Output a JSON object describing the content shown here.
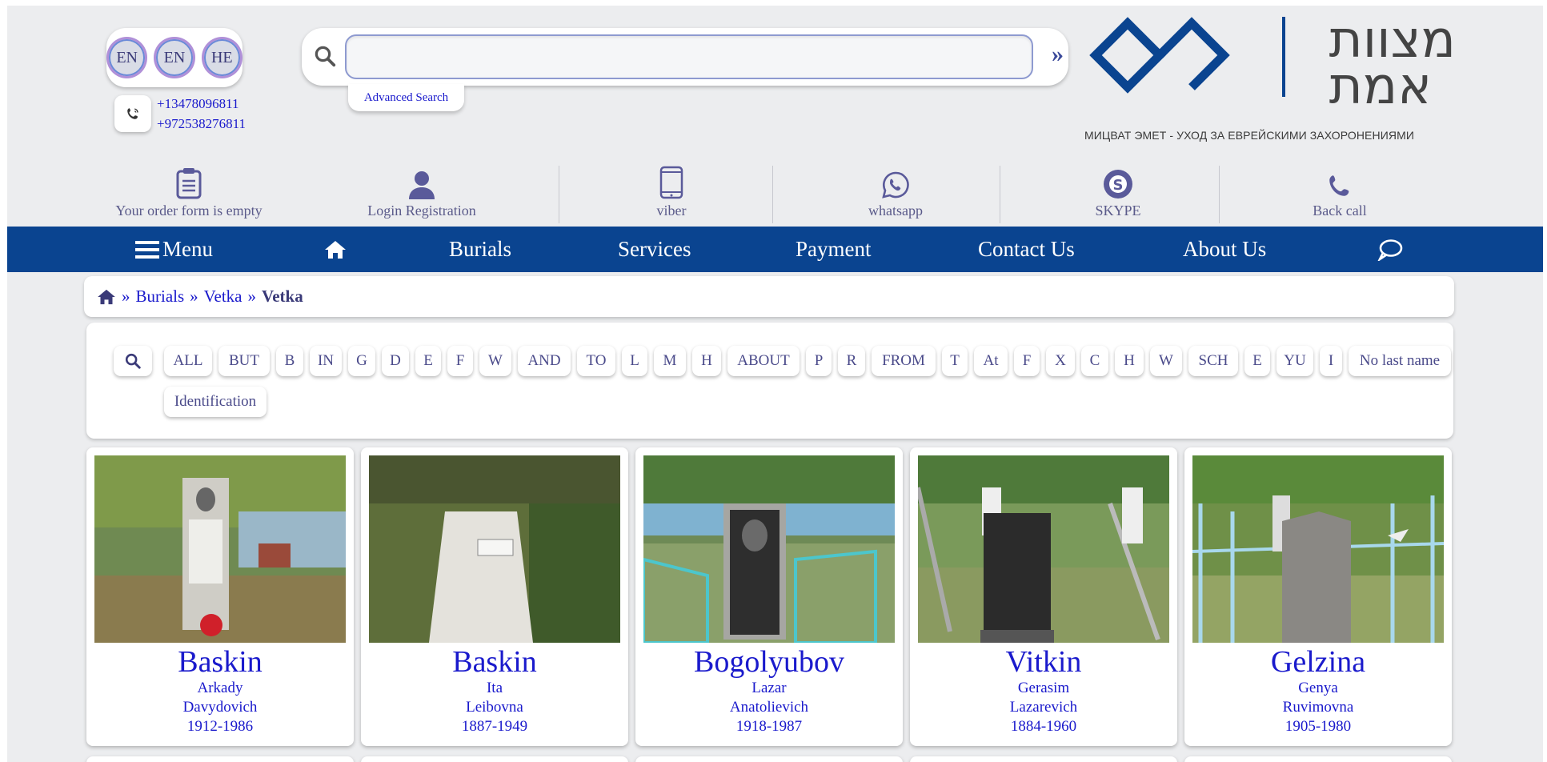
{
  "header": {
    "languages": [
      "EN",
      "EN",
      "HE"
    ],
    "phones": [
      "+13478096811",
      "+972538276811"
    ],
    "search": {
      "value": "",
      "placeholder": ""
    },
    "advanced_search": "Advanced Search",
    "logo_text_line1": "מצוות",
    "logo_text_line2": "אמת",
    "logo_subtitle": "МИЦВАТ ЭМЕТ - УХОД ЗА ЕВРЕЙСКИМИ ЗАХОРОНЕНИЯМИ"
  },
  "iconbar": {
    "order": "Your order form is empty",
    "login": "Login Registration",
    "viber": "viber",
    "whatsapp": "whatsapp",
    "skype": "SKYPE",
    "back_call": "Back call"
  },
  "nav": {
    "menu": "Menu",
    "burials": "Burials",
    "services": "Services",
    "payment": "Payment",
    "contact": "Contact Us",
    "about": "About Us"
  },
  "breadcrumb": [
    "Burials",
    "Vetka",
    "Vetka"
  ],
  "letters": {
    "row1": [
      "ALL",
      "BUT",
      "B",
      "IN",
      "G",
      "D",
      "E",
      "F",
      "W",
      "AND",
      "TO",
      "L",
      "M",
      "H",
      "ABOUT",
      "P",
      "R",
      "FROM",
      "T",
      "At",
      "F",
      "X",
      "C",
      "H",
      "W",
      "SCH",
      "E",
      "YU",
      "I",
      "No last name"
    ],
    "row2": [
      "Identification"
    ]
  },
  "cards": [
    {
      "surname": "Baskin",
      "first": "Arkady",
      "patronymic": "Davydovich",
      "years": "1912-1986"
    },
    {
      "surname": "Baskin",
      "first": "Ita",
      "patronymic": "Leibovna",
      "years": "1887-1949"
    },
    {
      "surname": "Bogolyubov",
      "first": "Lazar",
      "patronymic": "Anatolievich",
      "years": "1918-1987"
    },
    {
      "surname": "Vitkin",
      "first": "Gerasim",
      "patronymic": "Lazarevich",
      "years": "1884-1960"
    },
    {
      "surname": "Gelzina",
      "first": "Genya",
      "patronymic": "Ruvimovna",
      "years": "1905-1980"
    }
  ],
  "colors": {
    "nav_bg": "#0a4490",
    "link": "#1a1acc",
    "page_bg": "#ecedef"
  }
}
